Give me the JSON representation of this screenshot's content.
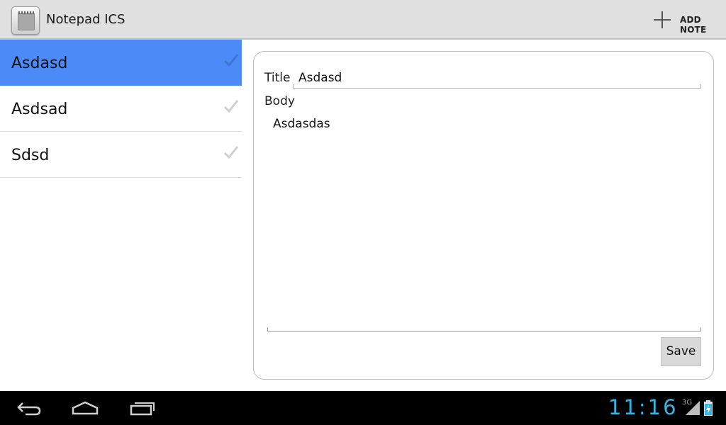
{
  "app": {
    "title": "Notepad ICS"
  },
  "action_bar": {
    "add_note_label": "ADD NOTE"
  },
  "notes": [
    {
      "title": "Asdasd",
      "selected": true
    },
    {
      "title": "Asdsad",
      "selected": false
    },
    {
      "title": "Sdsd",
      "selected": false
    }
  ],
  "editor": {
    "title_label": "Title",
    "title_value": "Asdasd",
    "body_label": "Body",
    "body_value": "Asdasdas",
    "save_label": "Save"
  },
  "system_bar": {
    "clock": "11:16",
    "network_type": "3G"
  },
  "colors": {
    "selected_item": "#4c8af8",
    "clock": "#33b5e5",
    "action_bar": "#e0e0e0"
  },
  "icons": [
    "app-icon",
    "plus-icon",
    "check-icon",
    "back-icon",
    "home-icon",
    "recents-icon",
    "signal-icon",
    "battery-icon"
  ]
}
